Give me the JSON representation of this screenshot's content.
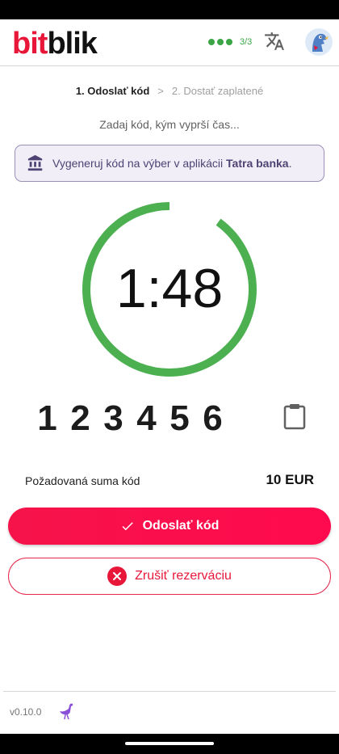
{
  "app": {
    "logo_bit": "bit",
    "logo_blik": "blik",
    "progress_label": "3/3",
    "accent_color": "#e8173a",
    "success_color": "#3ca647"
  },
  "icons": {
    "translate": "translate-icon",
    "avatar": "avatar",
    "bank": "bank-icon",
    "clipboard": "clipboard-icon",
    "check": "check-icon",
    "cancel": "close-circle-icon",
    "ostrich": "ostrich-icon"
  },
  "stepper": {
    "step1": "1. Odoslať kód",
    "separator": ">",
    "step2": "2. Dostať zaplatené"
  },
  "hint": "Zadaj kód, kým vyprší čas...",
  "info": {
    "text_before": "Vygeneruj kód na výber v aplikácii ",
    "bank_name": "Tatra banka",
    "text_after": "."
  },
  "timer": {
    "display": "1:48",
    "remaining_fraction": 0.9
  },
  "code": {
    "digits": [
      "1",
      "2",
      "3",
      "4",
      "5",
      "6"
    ]
  },
  "amount": {
    "label": "Požadovaná suma kód",
    "value": "10 EUR"
  },
  "actions": {
    "submit_label": "Odoslať kód",
    "cancel_label": "Zrušiť rezerváciu"
  },
  "footer": {
    "version": "v0.10.0"
  }
}
